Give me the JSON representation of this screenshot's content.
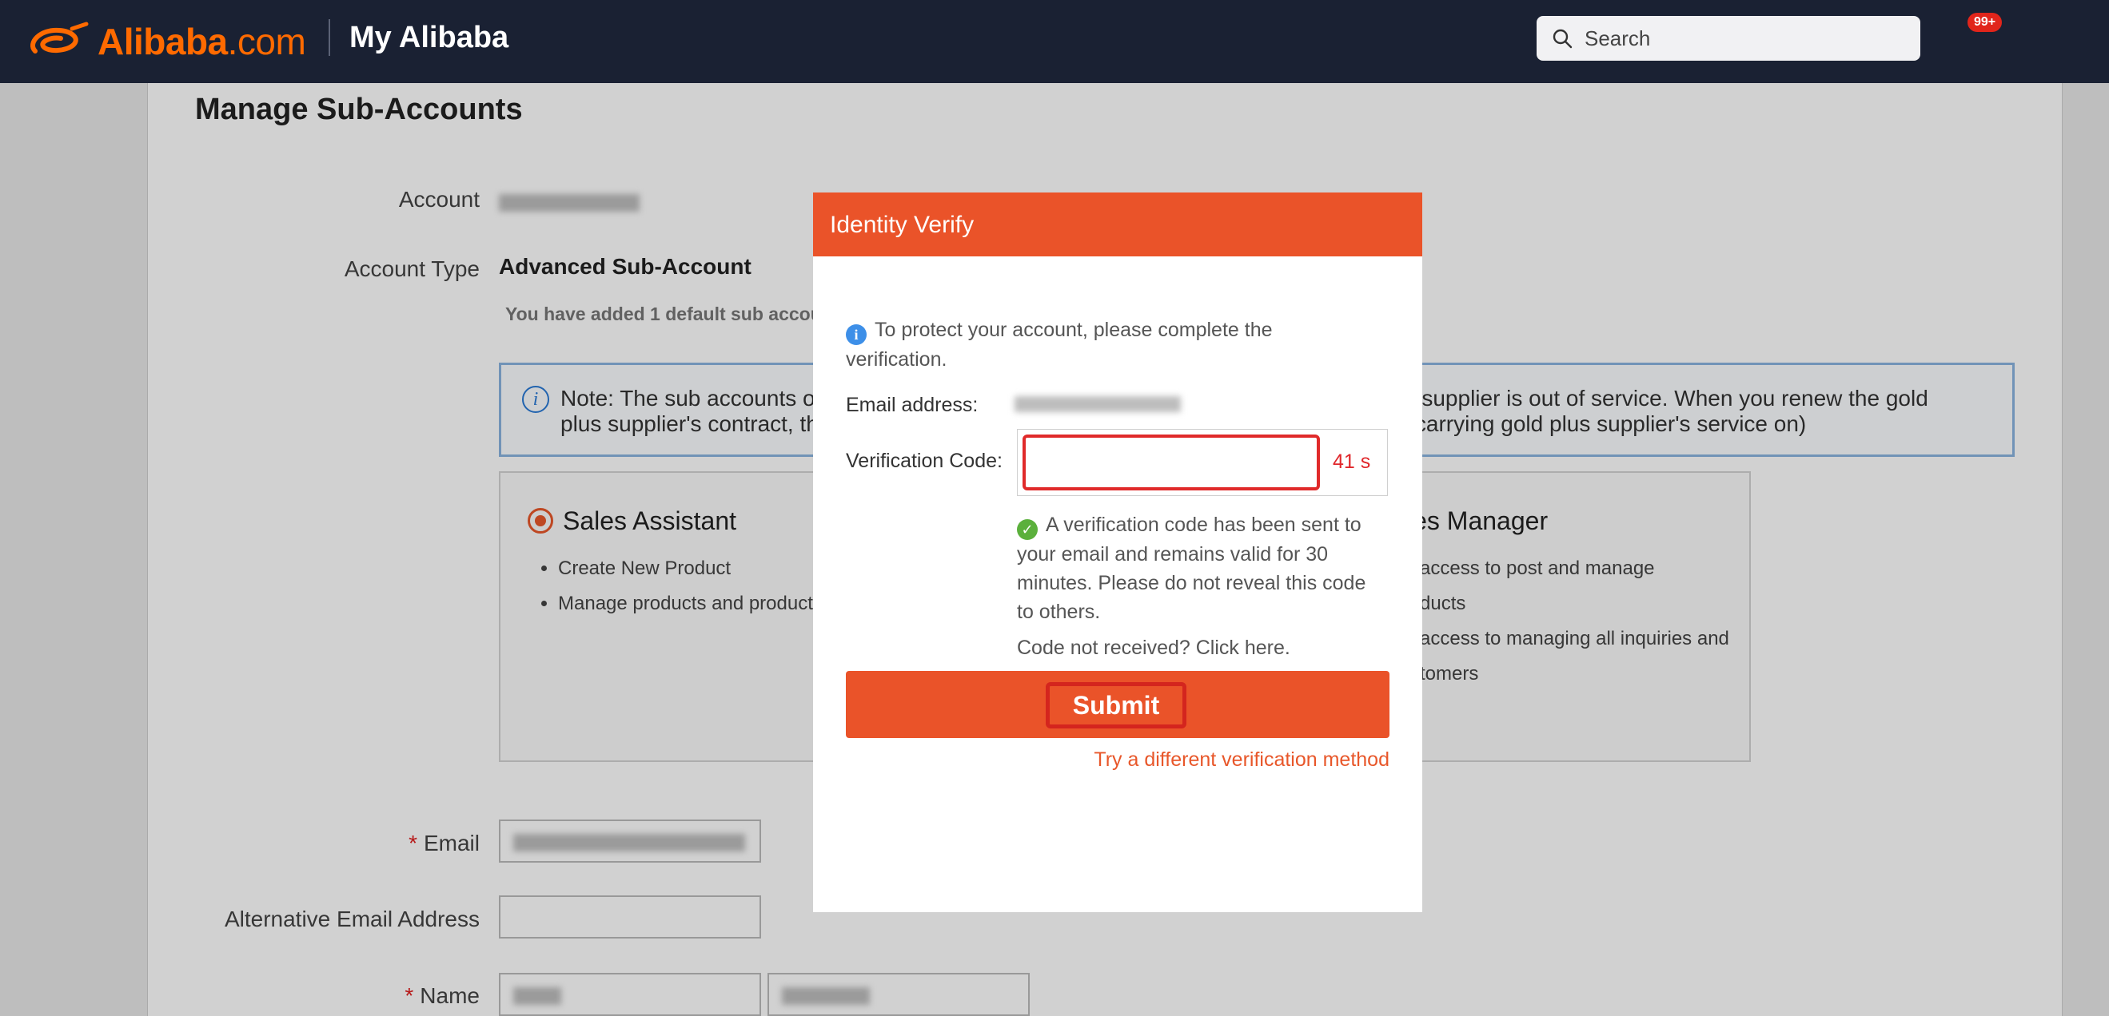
{
  "header": {
    "logo_text": "Alibaba",
    "logo_domain": ".com",
    "section_title": "My Alibaba",
    "search_placeholder": "Search",
    "notification_count": "99+"
  },
  "page": {
    "title": "Manage Sub-Accounts",
    "account_label": "Account",
    "account_type_label": "Account Type",
    "account_type_value": "Advanced Sub-Account",
    "added_text": "You have added 1 default sub accour",
    "note_left": "Note: The sub accounts of",
    "note_left2": "plus supplier's contract, th",
    "note_right": "us supplier is out of service. When you renew the gold",
    "note_right2": "y of carrying gold plus supplier's service on)",
    "cards": [
      {
        "title": "Sales Assistant",
        "items": [
          "Create New Product",
          "Manage products and product"
        ]
      },
      {
        "title": "les Manager",
        "items": [
          "access to post and manage",
          "ducts",
          "access to managing all inquiries and",
          "tomers"
        ]
      }
    ],
    "email_label": "Email",
    "alt_email_label": "Alternative Email Address",
    "name_label": "Name"
  },
  "modal": {
    "title": "Identity Verify",
    "info_text": "To protect your account, please complete the verification.",
    "email_label": "Email address:",
    "verification_label": "Verification Code:",
    "verification_value": "",
    "timer": "41 s",
    "sent_text": "A verification code has been sent to your email and remains valid for 30 minutes. Please do not reveal this code to others.",
    "not_received_text": "Code not received? Click here.",
    "submit_label": "Submit",
    "alt_method_label": "Try a different verification method"
  },
  "colors": {
    "brand_orange": "#ea5329",
    "header_bg": "#1a2133",
    "highlight_red": "#e02a2a"
  }
}
